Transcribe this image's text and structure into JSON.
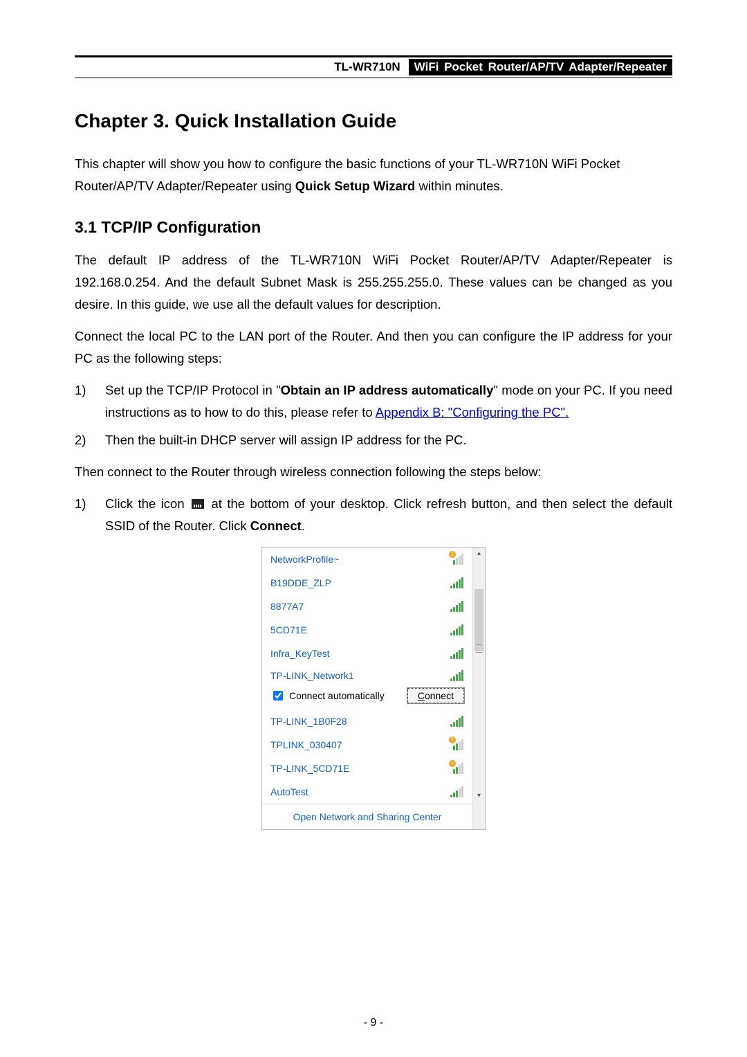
{
  "header": {
    "model": "TL-WR710N",
    "description": "WiFi Pocket Router/AP/TV Adapter/Repeater"
  },
  "chapter_title": "Chapter 3.  Quick Installation Guide",
  "intro_before": "This chapter will show you how to configure the basic functions of your TL-WR710N WiFi Pocket Router/AP/TV Adapter/Repeater using ",
  "intro_bold": "Quick Setup Wizard",
  "intro_after": " within minutes.",
  "section_title": "3.1  TCP/IP Configuration",
  "para1": "The default IP address of the TL-WR710N WiFi Pocket Router/AP/TV Adapter/Repeater is 192.168.0.254. And the default Subnet Mask is 255.255.255.0. These values can be changed as you desire. In this guide, we use all the default values for description.",
  "para2": "Connect the local PC to the LAN port of the Router. And then you can configure the IP address for your PC as the following steps:",
  "list1": {
    "item1_num": "1)",
    "item1_a": "Set up the TCP/IP Protocol in \"",
    "item1_bold": "Obtain an IP address automatically",
    "item1_b": "\" mode on your PC. If you need instructions as to how to do this, please refer to ",
    "item1_link": "Appendix B: \"Configuring the PC\".",
    "item2_num": "2)",
    "item2": "Then the built-in DHCP server will assign IP address for the PC."
  },
  "para3": "Then connect to the Router through wireless connection following the steps below:",
  "list2": {
    "item1_num": "1)",
    "item1_a": "Click the icon ",
    "item1_b": " at the bottom of your desktop. Click refresh button, and then select the default SSID of the Router. Click ",
    "item1_bold": "Connect",
    "item1_c": "."
  },
  "wifi": {
    "networks_top": [
      {
        "name": "NetworkProfile~",
        "signal": "grey",
        "alert": true
      },
      {
        "name": "B19DDE_ZLP",
        "signal": "s4"
      },
      {
        "name": "8877A7",
        "signal": "s4"
      },
      {
        "name": "5CD71E",
        "signal": "s4"
      },
      {
        "name": "Infra_KeyTest",
        "signal": "s4"
      }
    ],
    "selected": {
      "name": "TP-LINK_Network1",
      "signal": "s4",
      "auto_label": "Connect automatically",
      "connect_label": "Connect"
    },
    "networks_bottom": [
      {
        "name": "TP-LINK_1B0F28",
        "signal": "s4"
      },
      {
        "name": "TPLINK_030407",
        "signal": "s2",
        "alert": true
      },
      {
        "name": "TP-LINK_5CD71E",
        "signal": "s2",
        "alert": true
      },
      {
        "name": "AutoTest",
        "signal": "s2"
      }
    ],
    "footer": "Open Network and Sharing Center"
  },
  "page_number": "- 9 -"
}
